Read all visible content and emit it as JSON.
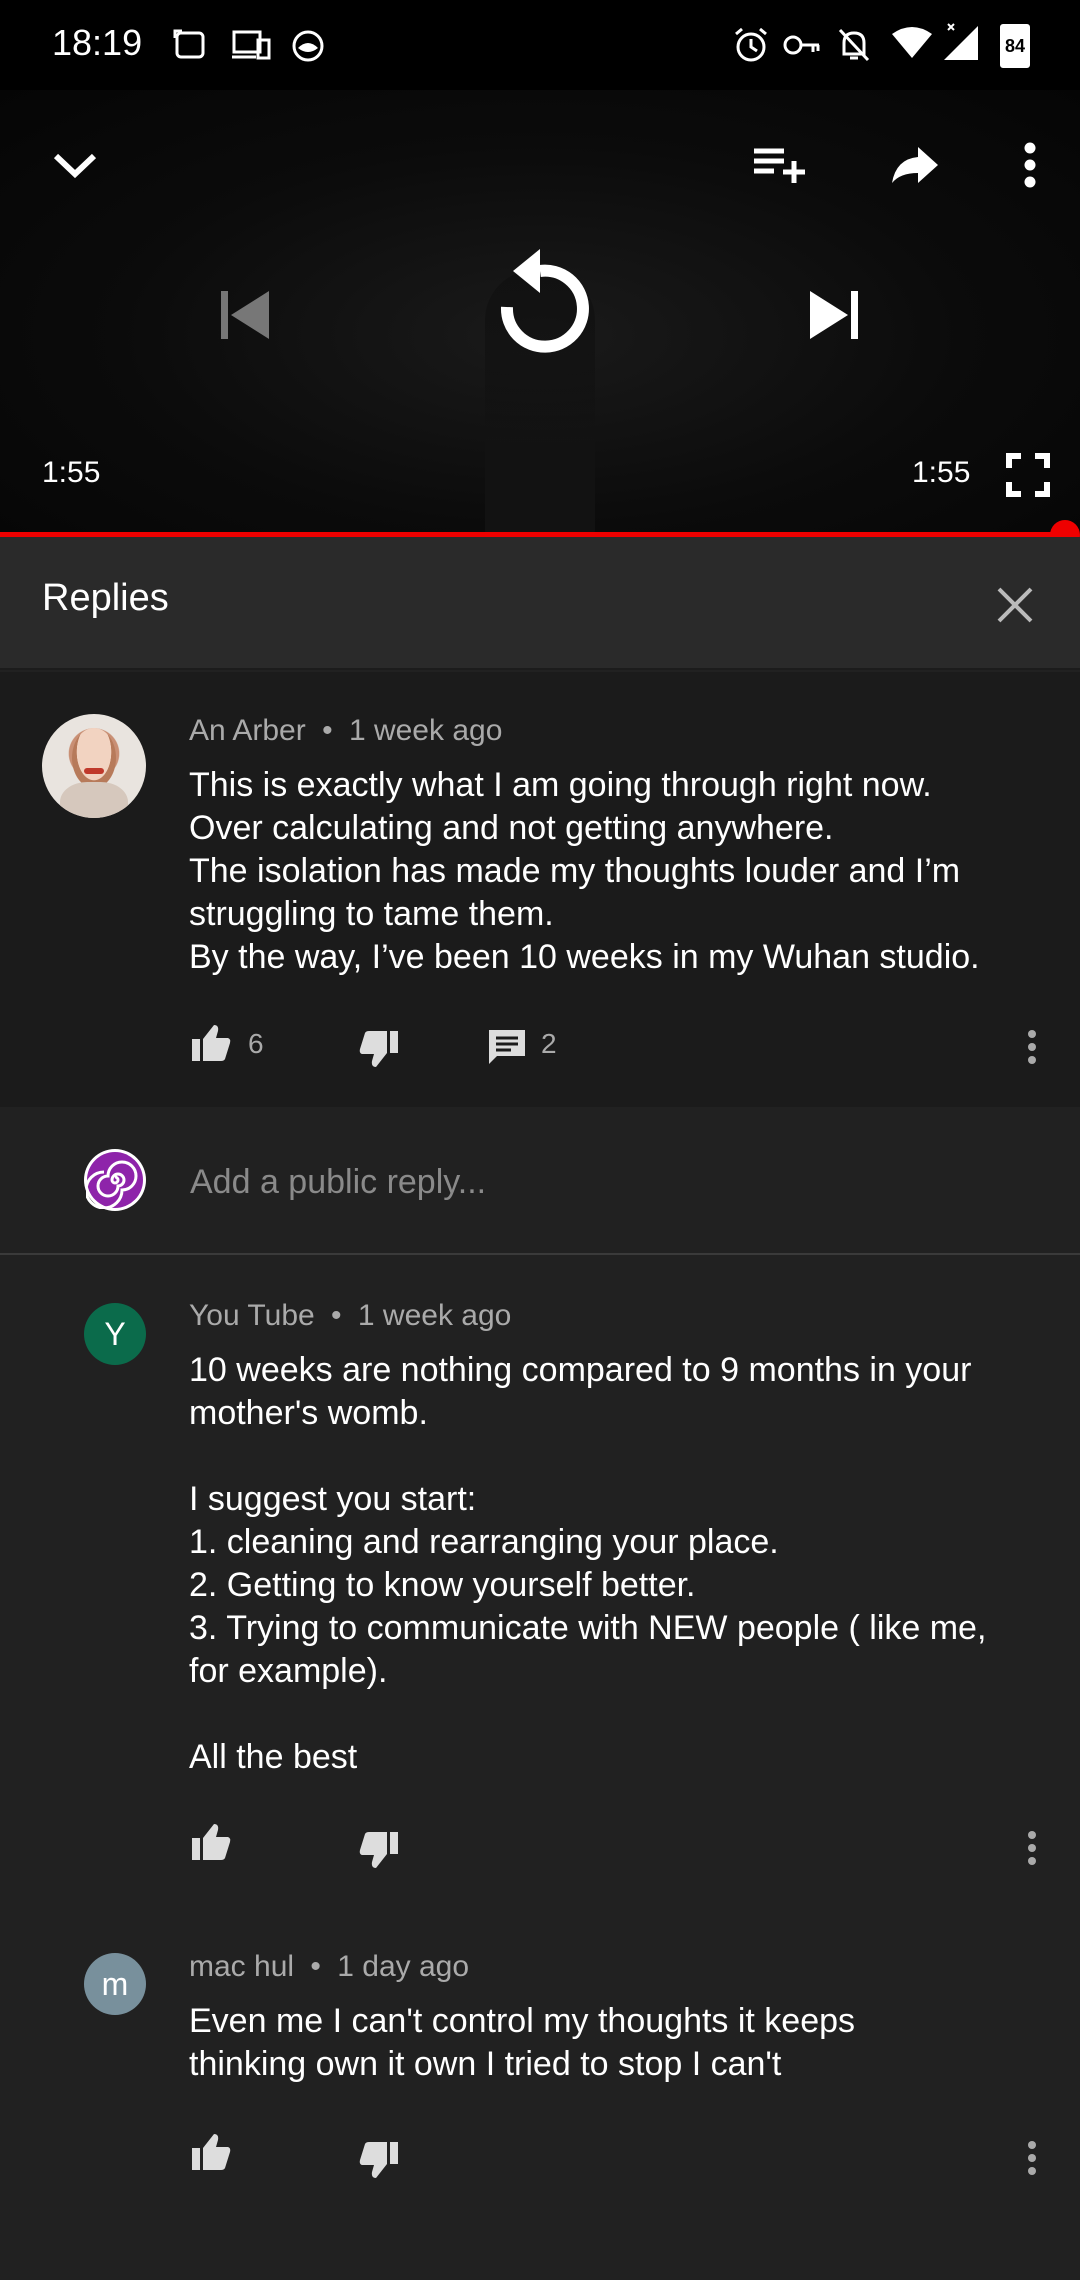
{
  "status_bar": {
    "time": "18:19",
    "battery": "84"
  },
  "player": {
    "current_time": "1:55",
    "duration": "1:55",
    "progress": 1.0
  },
  "replies": {
    "title": "Replies"
  },
  "parent_comment": {
    "author": "An Arber",
    "age": "1 week ago",
    "text": "This is exactly what I am going through right now.\nOver calculating and not getting anywhere.\nThe isolation has made my thoughts louder and I’m struggling to tame them.\nBy the way, I’ve been 10 weeks in my Wuhan studio.",
    "likes": "6",
    "reply_count": "2"
  },
  "reply_box": {
    "placeholder": "Add a public reply..."
  },
  "reply_list": [
    {
      "avatar_letter": "Y",
      "avatar_color": "#0b6b4b",
      "author": "You Tube",
      "age": "1 week ago",
      "text": "10 weeks are nothing compared to 9 months in your mother's womb.\n\nI suggest you start:\n1. cleaning and rearranging your place.\n2. Getting to know yourself better.\n3. Trying to communicate with NEW people ( like me, for example).\n\nAll the best"
    },
    {
      "avatar_letter": "m",
      "avatar_color": "#78909c",
      "author": "mac hul",
      "age": "1 day ago",
      "text": "Even me I can't control my thoughts it keeps thinking own it own I tried to stop I can't"
    }
  ],
  "colors": {
    "accent": "#ff0000",
    "background": "#212121",
    "meta_text": "#aaaaaa"
  }
}
